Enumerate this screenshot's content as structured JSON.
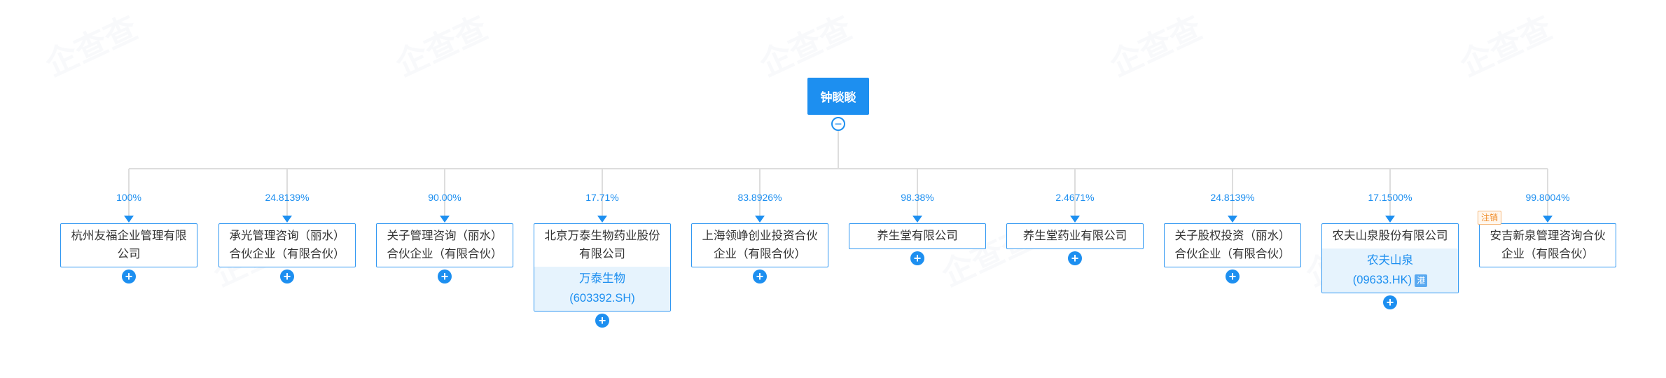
{
  "watermark": {
    "text": "企查查"
  },
  "root": {
    "name": "钟睒睒"
  },
  "children": [
    {
      "name": "杭州友福企业管理有限公司",
      "percent": "100%"
    },
    {
      "name": "承光管理咨询（丽水）合伙企业（有限合伙）",
      "percent": "24.8139%"
    },
    {
      "name": "关子管理咨询（丽水）合伙企业（有限合伙）",
      "percent": "90.00%"
    },
    {
      "name": "北京万泰生物药业股份有限公司",
      "percent": "17.71%",
      "stock_name": "万泰生物",
      "stock_code": "(603392.SH)"
    },
    {
      "name": "上海领峥创业投资合伙企业（有限合伙）",
      "percent": "83.8926%"
    },
    {
      "name": "养生堂有限公司",
      "percent": "98.38%"
    },
    {
      "name": "养生堂药业有限公司",
      "percent": "2.4671%"
    },
    {
      "name": "关子股权投资（丽水）合伙企业（有限合伙）",
      "percent": "24.8139%"
    },
    {
      "name": "农夫山泉股份有限公司",
      "percent": "17.1500%",
      "stock_name": "农夫山泉",
      "stock_code": "(09633.HK)",
      "stock_badge": "港"
    },
    {
      "name": "安吉新泉管理咨询合伙企业（有限合伙）",
      "percent": "99.8004%",
      "status": "注销"
    }
  ],
  "colors": {
    "accent": "#1d8ff0",
    "line": "#dddddd",
    "status": "#f08a24"
  }
}
